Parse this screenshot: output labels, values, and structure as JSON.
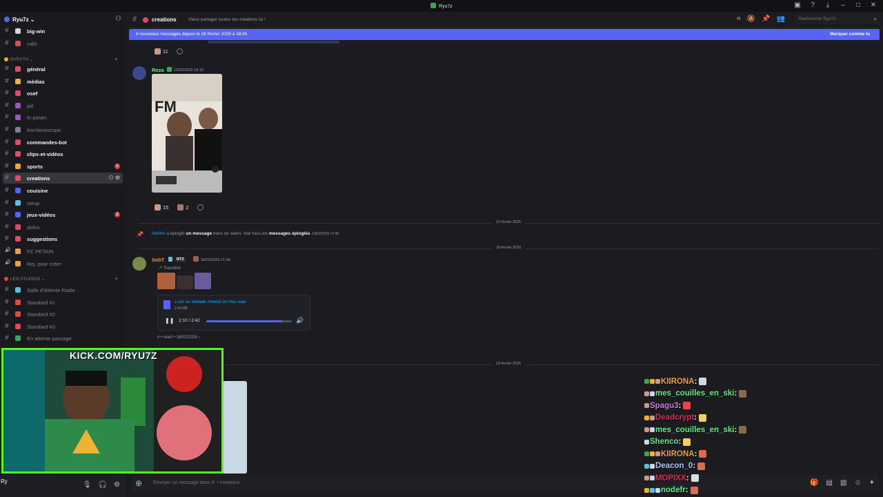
{
  "titlebar": {
    "title": "Ryu7z"
  },
  "server": {
    "name": "Ryu7z ⌄"
  },
  "channels_top": [
    {
      "label": "big-win",
      "unread": true,
      "color": "#c9d9e6"
    },
    {
      "label": "calls",
      "unread": false,
      "color": "#e04a4a"
    }
  ],
  "category_ryrytv": {
    "label": "RyRyTV ⌄",
    "plus": "+"
  },
  "channels_ryrytv": [
    {
      "label": "général",
      "unread": true,
      "color": "#e04a6b"
    },
    {
      "label": "médias",
      "unread": true,
      "color": "#f0b232"
    },
    {
      "label": "osef",
      "unread": true,
      "color": "#e04a6b"
    },
    {
      "label": "jail",
      "unread": false,
      "color": "#9b59b6"
    },
    {
      "label": "fc-petain",
      "unread": false,
      "color": "#9b59b6"
    },
    {
      "label": "trombinoscope",
      "unread": false,
      "color": "#80848e"
    },
    {
      "label": "commandes-bot",
      "unread": true,
      "color": "#e04a6b"
    },
    {
      "label": "clips-et-vidéos",
      "unread": true,
      "color": "#e04a6b"
    },
    {
      "label": "sports",
      "unread": true,
      "color": "#f0a040",
      "badge": "1"
    },
    {
      "label": "creations",
      "unread": true,
      "color": "#e04a6b",
      "active": true
    },
    {
      "label": "couisine",
      "unread": true,
      "color": "#5865f2"
    },
    {
      "label": "setup",
      "unread": false,
      "color": "#5bc0de"
    },
    {
      "label": "jeux-vidéos",
      "unread": true,
      "color": "#5865f2",
      "badge": "2"
    },
    {
      "label": "dofus",
      "unread": false,
      "color": "#e04a6b"
    },
    {
      "label": "suggestions",
      "unread": true,
      "color": "#e04a6b"
    },
    {
      "label": "FC PETAIN",
      "unread": false,
      "voice": true,
      "color": "#f0a040"
    },
    {
      "label": "Rej. pour créer",
      "unread": false,
      "voice": true,
      "color": "#f0a040"
    }
  ],
  "category_studios": {
    "label": "LES STUDIOS ⌄",
    "plus": "+"
  },
  "channels_studios": [
    {
      "label": "Salle d'Attente Radio",
      "unread": false,
      "color": "#5bc0de"
    },
    {
      "label": "Standard #1",
      "unread": false,
      "color": "#e04a4a"
    },
    {
      "label": "Standard #2",
      "unread": false,
      "color": "#e04a4a"
    },
    {
      "label": "Standard #3",
      "unread": false,
      "color": "#e04a4a"
    },
    {
      "label": "En attente passage",
      "unread": false,
      "color": "#3ba55c"
    }
  ],
  "user_panel": {
    "name": "Ry"
  },
  "channel_header": {
    "name": "creations",
    "topic": "Viens partager toutes tes créations ici !",
    "search_placeholder": "Rechercher Ryu7z"
  },
  "banner": {
    "text": "6 nouveaux messages depuis le 28 février 2026 à 18:45",
    "action": "Marquer comme lu"
  },
  "top_reactions": [
    {
      "count": "11"
    }
  ],
  "message_reza": {
    "author": "Reza",
    "author_color": "#57f287",
    "time": "12/02/2026 18:15",
    "reactions": [
      {
        "count": "15"
      },
      {
        "count": "2"
      }
    ]
  },
  "divider1": "12 février 2026",
  "system_pin": {
    "user": "0x84m",
    "text1": " a épinglé ",
    "link1": "un message",
    "text2": " dans ce salon. Voir tous les ",
    "link2": "messages épinglés",
    "time": ". 13/02/2026 17:49"
  },
  "divider2": "18 février 2026",
  "message_sebt": {
    "author": "SebT",
    "author_color": "#f28c28",
    "tag": "RTZ",
    "time": "18/02/2026 21:34",
    "forwarded": "↱ Transféré",
    "audio": {
      "file": "c est un malade mental ce mec.wav",
      "size": "2.42 MB",
      "time": "2:10 / 2:42",
      "progress": 0.89
    },
    "footer": "#  • react  •  18/02/2026  ›"
  },
  "divider3": "19 février 2026",
  "composer": {
    "placeholder": "Envoyer un message dans #  • creations"
  },
  "overlay": {
    "kick_text": "KICK.COM/RYU7Z"
  },
  "chat": [
    {
      "user": "KIIRONA",
      "color": "#f0a040",
      "badge_colors": [
        "#3ba55c",
        "#f0b232",
        "#c89a8a"
      ],
      "emote": "#c9d9e6"
    },
    {
      "user": "mes_couilles_en_ski",
      "color": "#57f287",
      "badge_colors": [
        "#c89a8a",
        "#c9d9e6"
      ],
      "emote": "#8b6a4a"
    },
    {
      "user": "Spagu3",
      "color": "#c678dd",
      "badge_colors": [
        "#c89a8a"
      ],
      "emote": "#e04a4a"
    },
    {
      "user": "Deadcrypt",
      "color": "#e0245e",
      "badge_colors": [
        "#f0b232",
        "#c89a8a"
      ],
      "emote": "#f0d060"
    },
    {
      "user": "mes_couilles_en_ski",
      "color": "#57f287",
      "badge_colors": [
        "#c89a8a",
        "#c9d9e6"
      ],
      "emote": "#8b6a4a"
    },
    {
      "user": "Shenco",
      "color": "#57f287",
      "badge_colors": [
        "#c9d9e6"
      ],
      "emote": "#f0d060"
    },
    {
      "user": "KIIRONA",
      "color": "#f0a040",
      "badge_colors": [
        "#3ba55c",
        "#f0b232",
        "#c89a8a"
      ],
      "emote": "#e06a4a"
    },
    {
      "user": "Deacon_0",
      "color": "#a8c8ff",
      "badge_colors": [
        "#5bc0de",
        "#c9d9e6"
      ],
      "emote": "#e06a4a"
    },
    {
      "user": "MOPIXX",
      "color": "#e0245e",
      "badge_colors": [
        "#c89a8a",
        "#c9d9e6"
      ],
      "emote": "#dddddd"
    },
    {
      "user": "nodefr",
      "color": "#57f287",
      "badge_colors": [
        "#f0b232",
        "#5bc0de",
        "#c9d9e6"
      ],
      "emote": "#e06a4a"
    }
  ]
}
